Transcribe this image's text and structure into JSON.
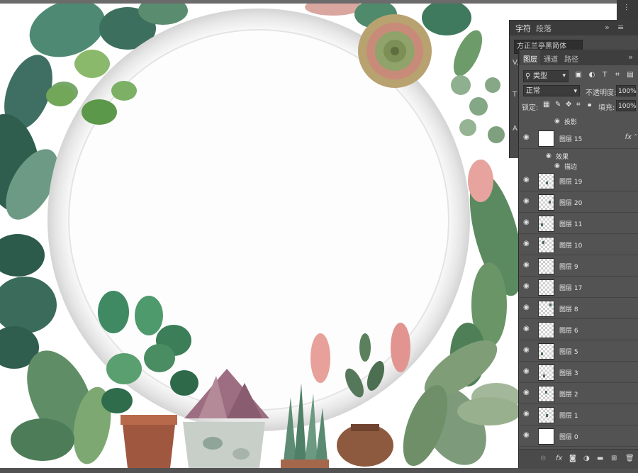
{
  "character_panel": {
    "tabs": [
      "字符",
      "段落"
    ],
    "font_field": "方正兰亭黑简体",
    "side_letters": [
      "V/",
      "T",
      "A"
    ]
  },
  "layers_panel": {
    "tabs": [
      "图层",
      "通道",
      "路径"
    ],
    "filter_kind": "类型",
    "blend_mode": "正常",
    "opacity_label": "不透明度:",
    "opacity_value": "100%",
    "lock_label": "锁定:",
    "fill_label": "填充:",
    "fill_value": "100%",
    "top_effect": "投影",
    "layer_15": {
      "name": "图层 15",
      "fx": "fx",
      "effects_label": "效果",
      "stroke_label": "描边"
    },
    "layers": [
      "图层 19",
      "图层 20",
      "图层 11",
      "图层 10",
      "图层 9",
      "图层 17",
      "图层 8",
      "图层 6",
      "图层 5",
      "图层 3",
      "图层 2",
      "图层 1",
      "图层 0"
    ],
    "footer_icons": [
      "link-icon",
      "fx-icon",
      "mask-icon",
      "adjustment-icon",
      "folder-icon",
      "new-layer-icon",
      "trash-icon"
    ]
  },
  "colors": {
    "panel_bg": "#535353",
    "panel_dark": "#3e3e3e",
    "leaf_dark": "#2f5d4e",
    "leaf_mid": "#4f8a6c",
    "leaf_light": "#86b37f",
    "pink": "#e0908c",
    "pot_terracotta": "#a0573f"
  }
}
